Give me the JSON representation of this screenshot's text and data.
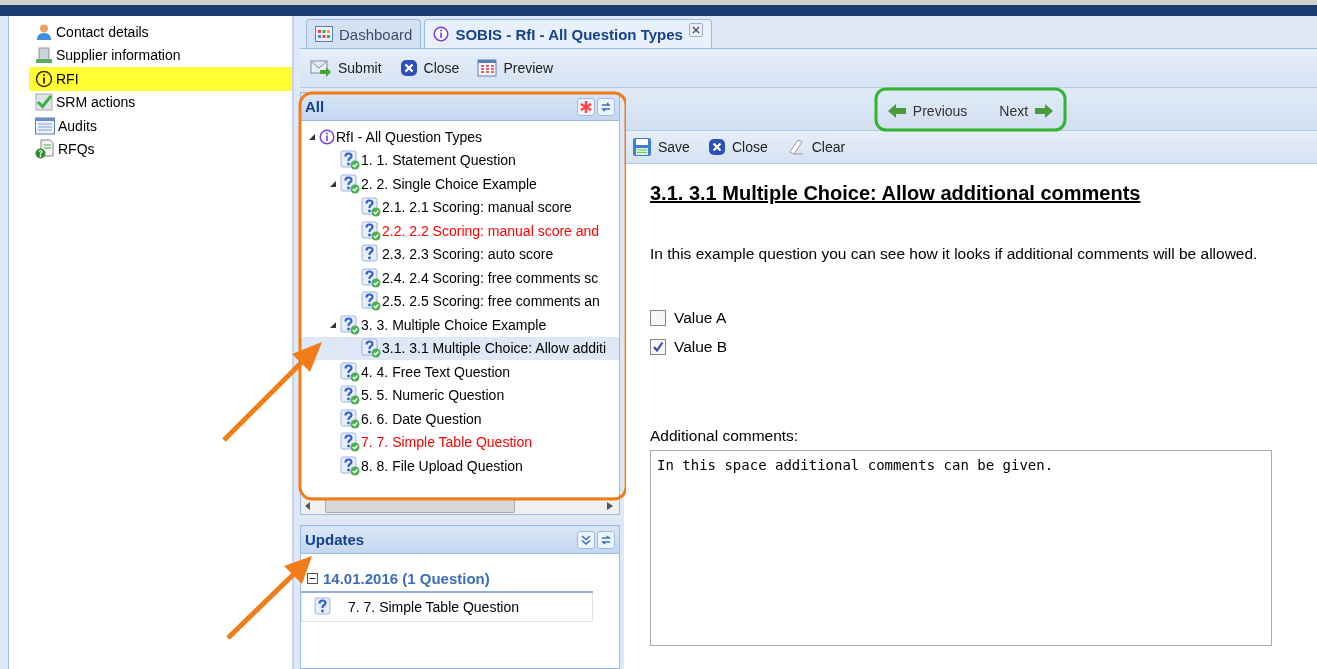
{
  "sidebar": {
    "items": [
      {
        "label": "Contact details",
        "kind": "contact",
        "highlighted": false
      },
      {
        "label": "Supplier information",
        "kind": "supplier",
        "highlighted": false
      },
      {
        "label": "RFI",
        "kind": "rfi",
        "highlighted": true
      },
      {
        "label": "SRM actions",
        "kind": "srm",
        "highlighted": false
      },
      {
        "label": "Audits",
        "kind": "audits",
        "highlighted": false
      },
      {
        "label": "RFQs",
        "kind": "rfq",
        "highlighted": false
      }
    ]
  },
  "tabs": [
    {
      "label": "Dashboard",
      "kind": "dashboard",
      "selected": false,
      "closable": false
    },
    {
      "label": "SOBIS - RfI - All Question Types",
      "kind": "rfi",
      "selected": true,
      "closable": true
    }
  ],
  "toolbar": [
    {
      "label": "Submit",
      "kind": "submit"
    },
    {
      "label": "Close",
      "kind": "close"
    },
    {
      "label": "Preview",
      "kind": "preview"
    }
  ],
  "tree_panel": {
    "title": "All",
    "tree": [
      {
        "label": "RfI - All Question Types",
        "kind": "rfi",
        "expanded": true,
        "children": [
          {
            "label": "1. 1. Statement Question",
            "kind": "question",
            "answered": true,
            "color": "#000000",
            "selected": false
          },
          {
            "label": "2. 2. Single Choice Example",
            "kind": "question",
            "answered": true,
            "color": "#000000",
            "selected": false,
            "expanded": true,
            "children": [
              {
                "label": "2.1. 2.1 Scoring: manual score",
                "kind": "question",
                "answered": true,
                "color": "#000000",
                "selected": false
              },
              {
                "label": "2.2. 2.2 Scoring: manual score and",
                "kind": "question",
                "answered": true,
                "color": "#ff0000",
                "selected": false
              },
              {
                "label": "2.3. 2.3 Scoring: auto score",
                "kind": "question",
                "answered": false,
                "color": "#000000",
                "selected": false
              },
              {
                "label": "2.4. 2.4 Scoring: free comments sc",
                "kind": "question",
                "answered": true,
                "color": "#000000",
                "selected": false
              },
              {
                "label": "2.5. 2.5 Scoring: free comments an",
                "kind": "question",
                "answered": true,
                "color": "#000000",
                "selected": false
              }
            ]
          },
          {
            "label": "3. 3. Multiple Choice Example",
            "kind": "question",
            "answered": true,
            "color": "#000000",
            "selected": false,
            "expanded": true,
            "children": [
              {
                "label": "3.1. 3.1 Multiple Choice: Allow additi",
                "kind": "question",
                "answered": true,
                "color": "#000000",
                "selected": true
              }
            ]
          },
          {
            "label": "4. 4. Free Text Question",
            "kind": "question",
            "answered": true,
            "color": "#000000",
            "selected": false
          },
          {
            "label": "5. 5. Numeric Question",
            "kind": "question",
            "answered": true,
            "color": "#000000",
            "selected": false
          },
          {
            "label": "6. 6. Date Question",
            "kind": "question",
            "answered": true,
            "color": "#000000",
            "selected": false
          },
          {
            "label": "7. 7. Simple Table Question",
            "kind": "question",
            "answered": true,
            "color": "#ff0000",
            "selected": false
          },
          {
            "label": "8. 8. File Upload Question",
            "kind": "question",
            "answered": true,
            "color": "#000000",
            "selected": false
          }
        ]
      }
    ]
  },
  "updates_panel": {
    "title": "Updates",
    "groups": [
      {
        "label": "14.01.2016 (1 Question)",
        "expanded": true,
        "items": [
          {
            "label": "7. 7. Simple Table Question"
          }
        ]
      }
    ]
  },
  "nav": {
    "previous": "Previous",
    "next": "Next"
  },
  "form_toolbar": [
    {
      "label": "Save",
      "kind": "save"
    },
    {
      "label": "Close",
      "kind": "close"
    },
    {
      "label": "Clear",
      "kind": "clear"
    }
  ],
  "question": {
    "title": "3.1. 3.1 Multiple Choice: Allow additional comments",
    "text": "In this example question you can see how it looks if additional comments will be allowed.",
    "options": [
      {
        "label": "Value A",
        "checked": false
      },
      {
        "label": "Value B",
        "checked": true
      }
    ],
    "comments_label": "Additional comments:",
    "comments_value": "In this space additional comments can be given."
  }
}
